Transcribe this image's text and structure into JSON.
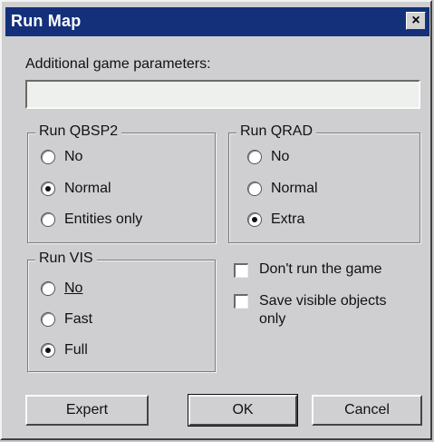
{
  "window": {
    "title": "Run Map",
    "close_glyph": "×"
  },
  "params": {
    "label": "Additional game parameters:",
    "value": ""
  },
  "qbsp2": {
    "title": "Run QBSP2",
    "options": [
      "No",
      "Normal",
      "Entities only"
    ],
    "selected": "Normal"
  },
  "qrad": {
    "title": "Run QRAD",
    "options": [
      "No",
      "Normal",
      "Extra"
    ],
    "selected": "Extra"
  },
  "vis": {
    "title": "Run VIS",
    "options": [
      "No",
      "Fast",
      "Full"
    ],
    "selected": "Full"
  },
  "checks": {
    "dont_run": {
      "label": "Don't run the game",
      "checked": false
    },
    "save_visible": {
      "label": "Save visible objects only",
      "checked": false
    }
  },
  "buttons": {
    "expert": "Expert",
    "ok": "OK",
    "cancel": "Cancel"
  }
}
